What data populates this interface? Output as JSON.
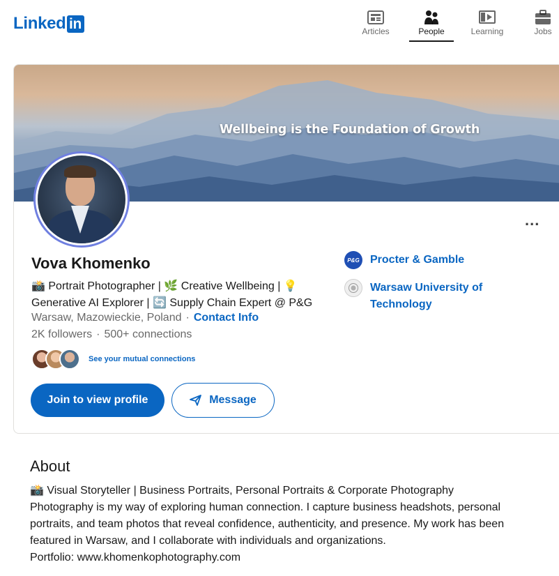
{
  "brand": {
    "logo_text": "Linked",
    "logo_box": "in"
  },
  "nav": [
    {
      "label": "Articles",
      "icon": "articles-icon"
    },
    {
      "label": "People",
      "icon": "people-icon",
      "active": true
    },
    {
      "label": "Learning",
      "icon": "learning-icon"
    },
    {
      "label": "Jobs",
      "icon": "jobs-icon"
    }
  ],
  "profile": {
    "banner_text": "Wellbeing is the Foundation of Growth",
    "name": "Vova Khomenko",
    "headline_line1": "📸 Portrait Photographer | 🌿 Creative Wellbeing | 💡",
    "headline_line2": "Generative AI Explorer | 🔄 Supply Chain Expert @ P&G",
    "location": "Warsaw, Mazowieckie, Poland",
    "contact_info": "Contact Info",
    "followers": "2K followers",
    "connections": "500+ connections",
    "mutual_text": "See your mutual connections",
    "join_button": "Join to view profile",
    "message_button": "Message",
    "more_menu": "...",
    "organizations": [
      {
        "name": "Procter & Gamble",
        "logo_text": "P&G",
        "color": "#1f4fb4"
      },
      {
        "name": "Warsaw University of Technology",
        "logo_text": "",
        "color": "#dcdcdc"
      }
    ]
  },
  "about": {
    "title": "About",
    "lines": [
      "📸 Visual Storyteller | Business Portraits, Personal Portraits & Corporate Photography",
      "Photography is my way of exploring human connection. I capture business headshots, personal",
      "portraits, and team photos that reveal confidence, authenticity, and presence. My work has been",
      "featured in Warsaw, and I collaborate with individuals and organizations.",
      "Portfolio: www.khomenkophotography.com"
    ]
  },
  "colors": {
    "brand": "#0a66c2",
    "avatar_ring": "#6f7fe0"
  }
}
